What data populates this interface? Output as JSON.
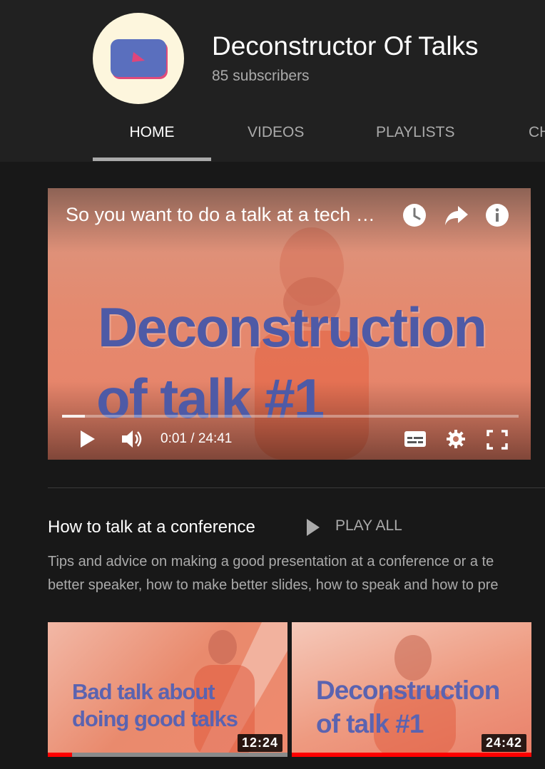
{
  "channel": {
    "name": "Deconstructor Of Talks",
    "subscribers": "85 subscribers",
    "accent": "#5a6fbe"
  },
  "tabs": [
    {
      "label": "HOME",
      "selected": true
    },
    {
      "label": "VIDEOS",
      "selected": false
    },
    {
      "label": "PLAYLISTS",
      "selected": false
    },
    {
      "label": "CH",
      "selected": false
    }
  ],
  "player": {
    "title": "So you want to do a talk at a tech …",
    "overlay_line1": "Deconstruction",
    "overlay_line2": "of talk #1",
    "time": "0:01 / 24:41",
    "progress": 0.05,
    "icons": [
      "watch-later-icon",
      "share-icon",
      "info-icon",
      "play-icon",
      "volume-icon",
      "subtitles-icon",
      "settings-icon",
      "fullscreen-icon"
    ]
  },
  "section": {
    "title": "How to talk at a conference",
    "play_all": "PLAY ALL",
    "desc_line1": "Tips and advice on making a good presentation at a conference or a te",
    "desc_line2": "better speaker, how to make better slides, how to speak and how to pre"
  },
  "videos": [
    {
      "line1": "Bad talk about",
      "line2": "doing good talks",
      "duration": "12:24",
      "watched": 0.1
    },
    {
      "line1": "Deconstruction",
      "line2": "of talk #1",
      "duration": "24:42",
      "watched": 1.0
    }
  ]
}
